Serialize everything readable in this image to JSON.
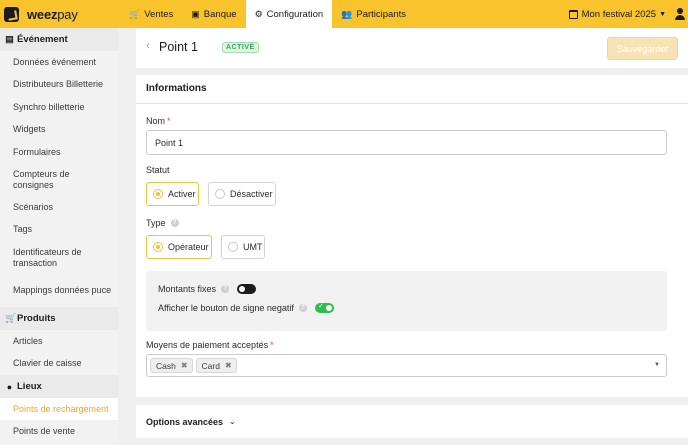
{
  "brand": {
    "name_bold": "weez",
    "name_light": "pay"
  },
  "nav": [
    {
      "label": "Ventes",
      "icon": "cart-icon"
    },
    {
      "label": "Banque",
      "icon": "bank-icon"
    },
    {
      "label": "Configuration",
      "icon": "gear-icon",
      "active": true
    },
    {
      "label": "Participants",
      "icon": "users-icon"
    }
  ],
  "festival": {
    "label": "Mon festival 2025"
  },
  "sidebar": {
    "sections": [
      {
        "title": "Événement",
        "icon": "calendar-icon"
      },
      {
        "title": "Produits",
        "icon": "cart-icon"
      },
      {
        "title": "Lieux",
        "icon": "pin-icon"
      }
    ],
    "evenement_items": [
      "Données événement",
      "Distributeurs Billetterie",
      "Synchro billetterie",
      "Widgets",
      "Formulaires",
      "Compteurs de consignes",
      "Scénarios",
      "Tags",
      "Identificateurs de transaction",
      "Mappings données puce"
    ],
    "produits_items": [
      "Articles",
      "Clavier de caisse"
    ],
    "lieux_items": [
      "Points de rechargement",
      "Points de vente"
    ]
  },
  "header": {
    "title": "Point 1",
    "badge": "ACTIVÉ",
    "save_label": "Sauvegarder"
  },
  "form": {
    "section_title": "Informations",
    "nom_label": "Nom",
    "required_mark": "*",
    "nom_value": "Point 1",
    "statut_label": "Statut",
    "statut_options": [
      "Activer",
      "Désactiver"
    ],
    "statut_selected": "Activer",
    "type_label": "Type",
    "type_options": [
      "Opérateur",
      "UMT"
    ],
    "type_selected": "Opérateur",
    "montants_label": "Montants fixes",
    "montants_on": false,
    "signe_label": "Afficher le bouton de signe negatif",
    "signe_on": true,
    "help_glyph": "?",
    "moyens_label": "Moyens de paiement acceptés",
    "moyens_values": [
      "Cash",
      "Card"
    ]
  },
  "advanced": {
    "label": "Options avancées"
  },
  "colors": {
    "brand_yellow": "#f9c32c",
    "active_link": "#e9a81f",
    "success_green": "#2fbf4e"
  }
}
